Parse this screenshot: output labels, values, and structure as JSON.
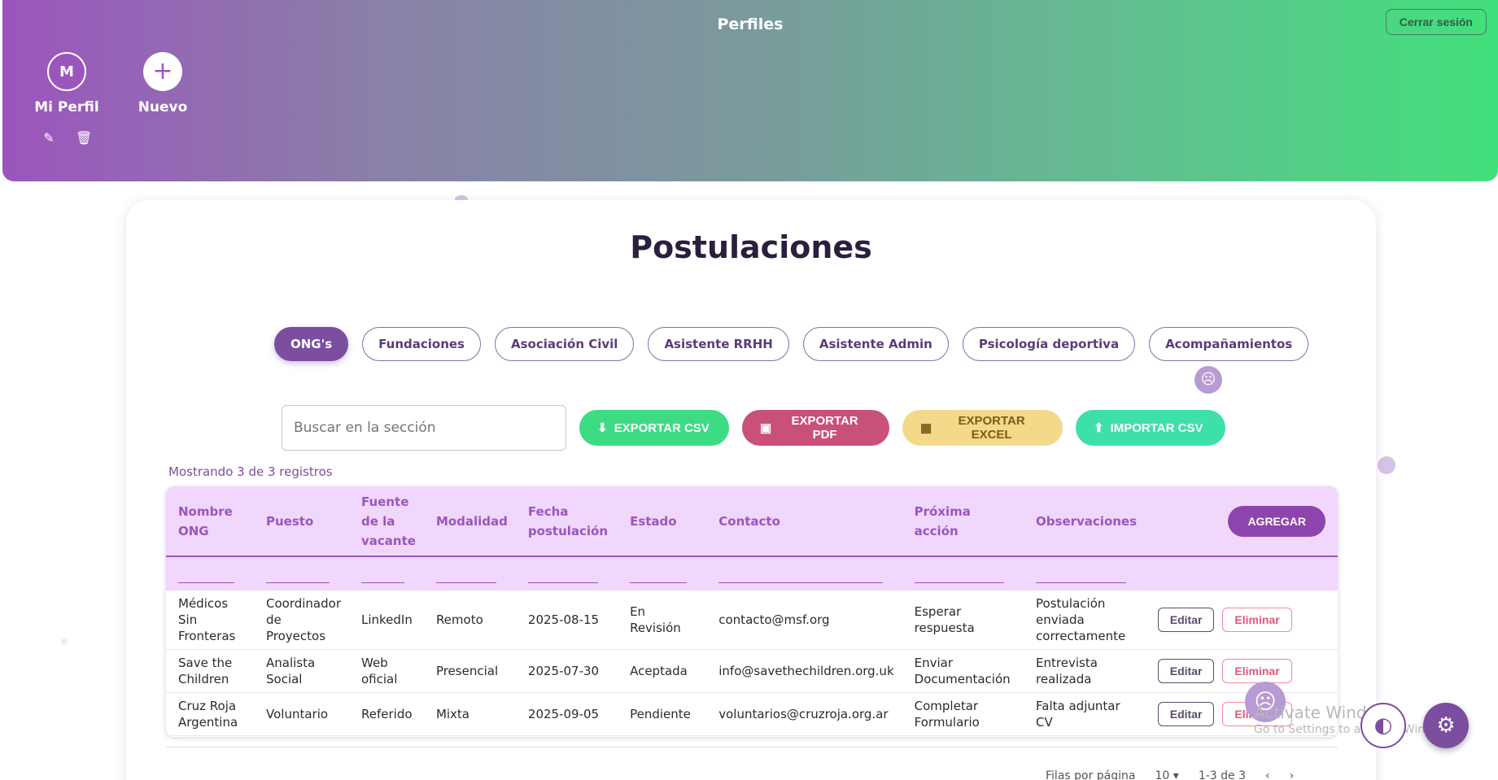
{
  "header": {
    "title": "Perfiles",
    "logout_label": "Cerrar sesión",
    "profiles": [
      {
        "initial": "M",
        "name": "Mi Perfil"
      },
      {
        "initial": "+",
        "name": "Nuevo"
      }
    ],
    "colors": {
      "gradient_start": "#9b55bd",
      "gradient_end": "#42e07c"
    }
  },
  "main": {
    "title": "Postulaciones",
    "tabs": [
      "ONG's",
      "Fundaciones",
      "Asociación Civil",
      "Asistente RRHH",
      "Asistente Admin",
      "Psicología deportiva",
      "Acompañamientos"
    ],
    "active_tab": "ONG's",
    "search": {
      "placeholder": "Buscar en la sección"
    },
    "buttons": {
      "export_csv": "EXPORTAR CSV",
      "export_pdf": "EXPORTAR PDF",
      "export_excel": "EXPORTAR EXCEL",
      "import_csv": "IMPORTAR CSV",
      "add": "AGREGAR",
      "edit": "Editar",
      "delete": "Eliminar"
    },
    "records_text": "Mostrando 3 de 3 registros"
  },
  "table": {
    "columns": [
      "Nombre ONG",
      "Puesto",
      "Fuente de la vacante",
      "Modalidad",
      "Fecha postulación",
      "Estado",
      "Contacto",
      "Próxima acción",
      "Observaciones"
    ],
    "rows": [
      {
        "nombre": "Médicos Sin Fronteras",
        "puesto": "Coordinador de Proyectos",
        "fuente": "LinkedIn",
        "modalidad": "Remoto",
        "fecha": "2025-08-15",
        "estado": "En Revisión",
        "contacto": "contacto@msf.org",
        "accion": "Esperar respuesta",
        "obs": "Postulación enviada correctamente"
      },
      {
        "nombre": "Save the Children",
        "puesto": "Analista Social",
        "fuente": "Web oficial",
        "modalidad": "Presencial",
        "fecha": "2025-07-30",
        "estado": "Aceptada",
        "contacto": "info@savethechildren.org.uk",
        "accion": "Enviar Documentación",
        "obs": "Entrevista realizada"
      },
      {
        "nombre": "Cruz Roja Argentina",
        "puesto": "Voluntario",
        "fuente": "Referido",
        "modalidad": "Mixta",
        "fecha": "2025-09-05",
        "estado": "Pendiente",
        "contacto": "voluntarios@cruzroja.org.ar",
        "accion": "Completar Formulario",
        "obs": "Falta adjuntar CV"
      }
    ]
  },
  "pagination": {
    "rows_per_page_label": "Filas por página",
    "rows_per_page": "10",
    "range": "1-3 de 3"
  },
  "overlay": {
    "watermark_title": "Activate Windows",
    "watermark_sub": "Go to Settings to activate Windows."
  }
}
